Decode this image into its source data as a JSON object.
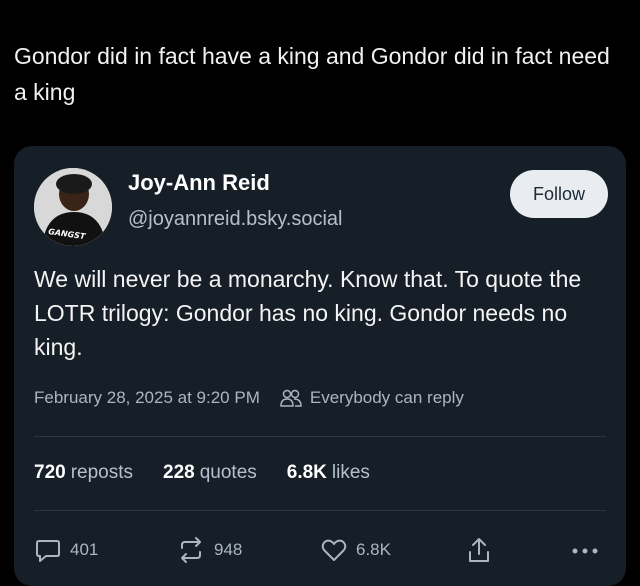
{
  "caption": "Gondor did in fact have a king and Gondor did in fact need a king",
  "post": {
    "author_name": "Joy-Ann Reid",
    "handle": "@joyannreid.bsky.social",
    "follow_label": "Follow",
    "avatar_shirt_text": "GANGST",
    "text": "We will never be a monarchy. Know that. To quote the LOTR trilogy: Gondor has no king. Gondor needs no king.",
    "timestamp": "February 28, 2025 at 9:20 PM",
    "reply_setting": "Everybody can reply",
    "stats": {
      "reposts_count": "720",
      "reposts_label": "reposts",
      "quotes_count": "228",
      "quotes_label": "quotes",
      "likes_count": "6.8K",
      "likes_label": "likes"
    },
    "actions": {
      "reply_count": "401",
      "repost_count": "948",
      "like_count": "6.8K"
    }
  },
  "colors": {
    "page_bg": "#000000",
    "card_bg": "#161e27",
    "secondary_text": "#aab6c2",
    "follow_bg": "#e9edf2"
  }
}
